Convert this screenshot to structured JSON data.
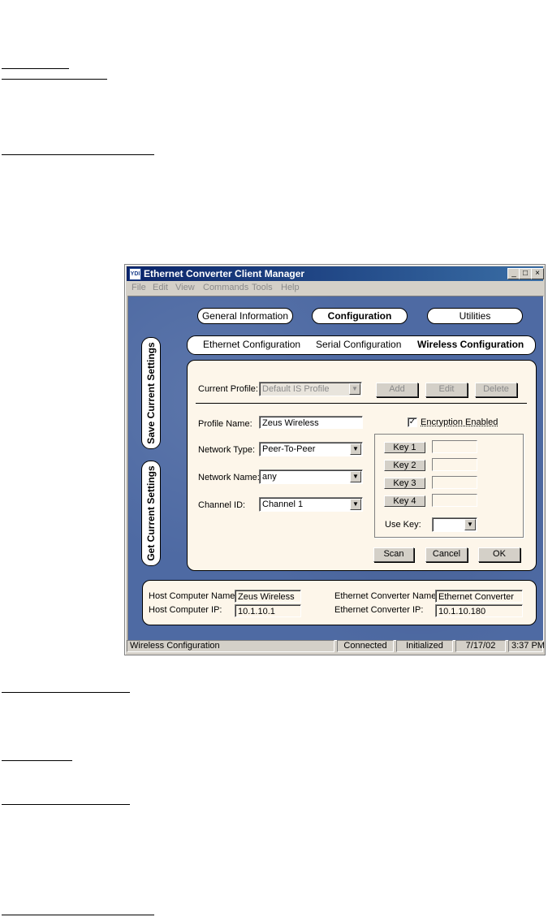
{
  "window": {
    "title": "Ethernet Converter Client Manager",
    "app_icon_text": "YDI",
    "controls": {
      "minimize": "_",
      "maximize": "□",
      "close": "×"
    }
  },
  "menu": [
    "File",
    "Edit",
    "View",
    "Commands",
    "Tools",
    "Help"
  ],
  "main_tabs": [
    {
      "label": "General Information",
      "selected": false
    },
    {
      "label": "Configuration",
      "selected": true
    },
    {
      "label": "Utilities",
      "selected": false
    }
  ],
  "sub_tabs": [
    {
      "label": "Ethernet Configuration",
      "selected": false
    },
    {
      "label": "Serial Configuration",
      "selected": false
    },
    {
      "label": "Wireless Configuration",
      "selected": true
    }
  ],
  "side_buttons": {
    "save": "Save Current Settings",
    "get": "Get Current Settings"
  },
  "profile": {
    "current_label": "Current Profile:",
    "current_value": "Default IS Profile",
    "add": "Add",
    "edit": "Edit",
    "delete": "Delete"
  },
  "form": {
    "profile_name_label": "Profile Name:",
    "profile_name_value": "Zeus Wireless",
    "network_type_label": "Network Type:",
    "network_type_value": "Peer-To-Peer",
    "network_name_label": "Network Name:",
    "network_name_value": "any",
    "channel_label": "Channel ID:",
    "channel_value": "Channel 1",
    "encryption_label": "Encryption Enabled",
    "encryption_checked": true,
    "keys": [
      "Key 1",
      "Key 2",
      "Key 3",
      "Key 4"
    ],
    "use_key_label": "Use Key:",
    "scan": "Scan",
    "cancel": "Cancel",
    "ok": "OK"
  },
  "host": {
    "host_name_label": "Host Computer Name:",
    "host_name_value": "Zeus Wireless",
    "host_ip_label": "Host Computer IP:",
    "host_ip_value": "10.1.10.1",
    "conv_name_label": "Ethernet Converter Name:",
    "conv_name_value": "Ethernet Converter",
    "conv_ip_label": "Ethernet Converter IP:",
    "conv_ip_value": "10.1.10.180"
  },
  "status": {
    "message": "Wireless Configuration",
    "connection": "Connected",
    "state": "Initialized",
    "date": "7/17/02",
    "time": "3:37 PM"
  },
  "colors": {
    "client_bg": "#4e6aa3",
    "panel_bg": "#fdf6ea",
    "title_bar": "#0a246a"
  }
}
